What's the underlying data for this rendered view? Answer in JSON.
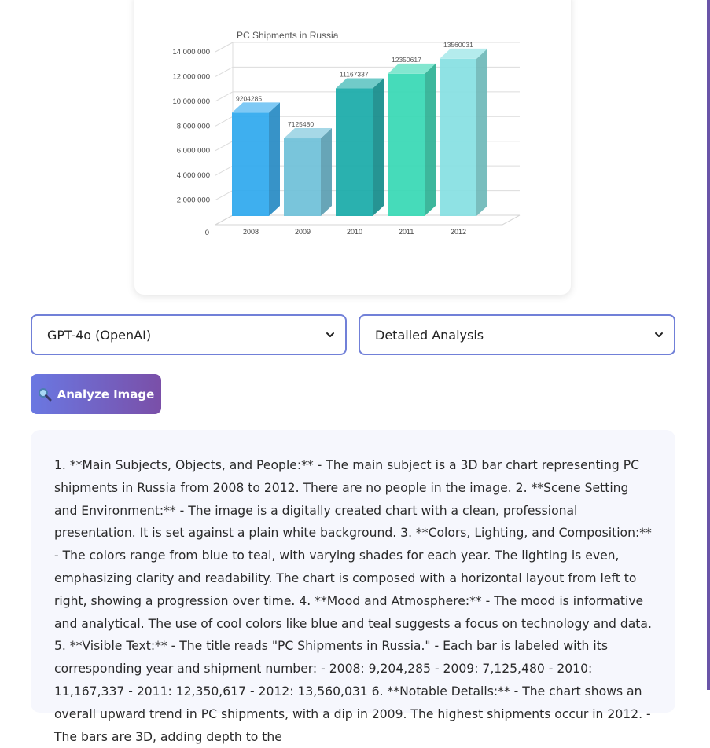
{
  "chart_data": {
    "type": "bar",
    "title": "PC Shipments in Russia",
    "categories": [
      "2008",
      "2009",
      "2010",
      "2011",
      "2012"
    ],
    "values": [
      9204285,
      7125480,
      11167337,
      12350617,
      13560031
    ],
    "value_labels": [
      "9204285",
      "7125480",
      "11167337",
      "12350617",
      "13560031"
    ],
    "y_ticks": [
      "0",
      "2 000 000",
      "4 000 000",
      "6 000 000",
      "8 000 000",
      "10 000 000",
      "12 000 000",
      "14 000 000"
    ],
    "ylim": [
      0,
      14000000
    ],
    "grid": true,
    "style": "3d",
    "colors": [
      "#2ea8ee",
      "#6ec0d8",
      "#18aaa8",
      "#36d8b4",
      "#86e0e2"
    ]
  },
  "controls": {
    "model_select": {
      "selected": "GPT-4o (OpenAI)"
    },
    "mode_select": {
      "selected": "Detailed Analysis"
    },
    "analyze_button": {
      "icon": "magnifier-icon",
      "label": "Analyze Image"
    }
  },
  "result": {
    "text": "1. **Main Subjects, Objects, and People:** - The main subject is a 3D bar chart representing PC shipments in Russia from 2008 to 2012. There are no people in the image. 2. **Scene Setting and Environment:** - The image is a digitally created chart with a clean, professional presentation. It is set against a plain white background. 3. **Colors, Lighting, and Composition:** - The colors range from blue to teal, with varying shades for each year. The lighting is even, emphasizing clarity and readability. The chart is composed with a horizontal layout from left to right, showing a progression over time. 4. **Mood and Atmosphere:** - The mood is informative and analytical. The use of cool colors like blue and teal suggests a focus on technology and data. 5. **Visible Text:** - The title reads \"PC Shipments in Russia.\" - Each bar is labeled with its corresponding year and shipment number: - 2008: 9,204,285 - 2009: 7,125,480 - 2010: 11,167,337 - 2011: 12,350,617 - 2012: 13,560,031 6. **Notable Details:** - The chart shows an overall upward trend in PC shipments, with a dip in 2009. The highest shipments occur in 2012. - The bars are 3D, adding depth to the"
  }
}
